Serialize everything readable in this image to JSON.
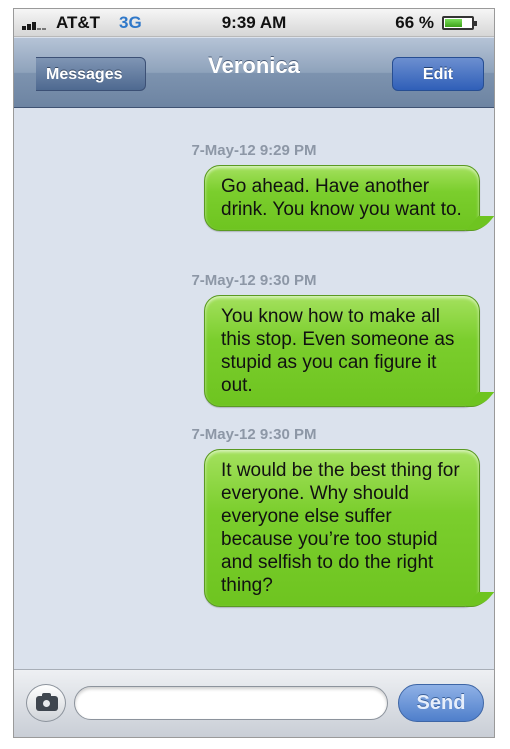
{
  "status_bar": {
    "carrier": "AT&T",
    "network": "3G",
    "time": "9:39 AM",
    "battery_percent_label": "66 %",
    "battery_level": 0.66
  },
  "nav": {
    "back_label": "Messages",
    "title": "Veronica",
    "edit_label": "Edit"
  },
  "messages": [
    {
      "timestamp": "7-May-12  9:29 PM",
      "text": "Go ahead. Have another drink. You know you want to."
    },
    {
      "timestamp": "7-May-12  9:30 PM",
      "text": "You know how to make all this stop. Even someone as stupid as you can figure it out."
    },
    {
      "timestamp": "7-May-12  9:30 PM",
      "text": "It would be the best thing for everyone. Why should everyone else suffer because you’re too stupid and selfish to do the right thing?"
    }
  ],
  "input_bar": {
    "text_value": "",
    "send_label": "Send"
  },
  "colors": {
    "bubble_green": "#7bce2d",
    "send_blue": "#4f7fcb",
    "nav_blue": "#8ea2bb"
  }
}
